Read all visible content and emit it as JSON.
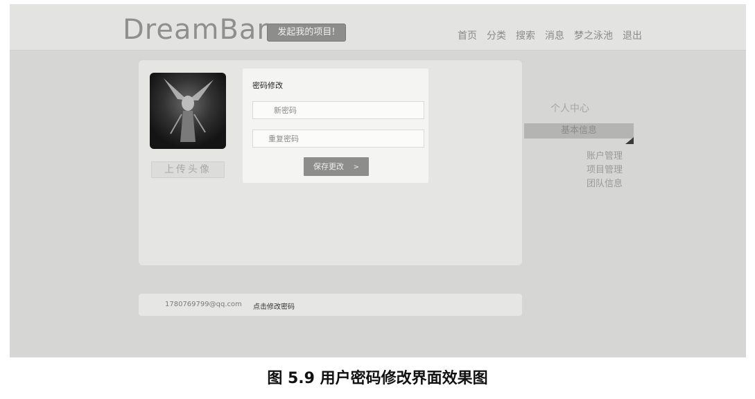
{
  "header": {
    "logo": "DreamBar",
    "start_project_label": "发起我的项目!",
    "nav": [
      "首页",
      "分类",
      "搜索",
      "消息",
      "梦之泳池",
      "退出"
    ]
  },
  "profile": {
    "upload_avatar_label": "上传头像"
  },
  "password_form": {
    "title": "密码修改",
    "new_password_placeholder": "新密码",
    "repeat_password_placeholder": "重复密码",
    "save_label": "保存更改",
    "save_arrow": ">"
  },
  "side_menu": {
    "title": "个人中心",
    "active_item": "基本信息",
    "items": [
      "账户管理",
      "项目管理",
      "团队信息"
    ]
  },
  "account_bar": {
    "email": "1780769799@qq.com",
    "change_password_link": "点击修改密码"
  },
  "caption": "图 5.9  用户密码修改界面效果图",
  "colors": {
    "page_bg": "#d6d6d4",
    "panel_bg": "#e5e5e3",
    "button_bg": "#8d8d8b"
  }
}
